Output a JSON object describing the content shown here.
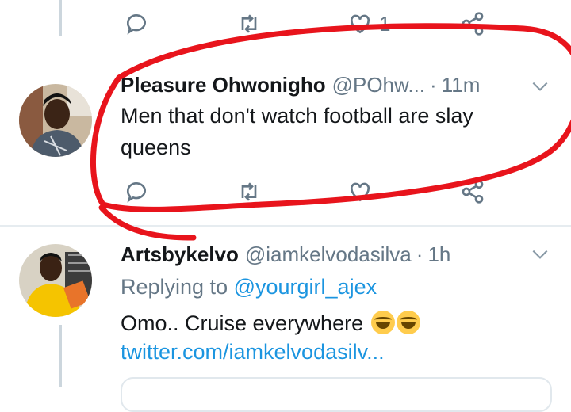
{
  "top_actions": {
    "like_count": "1"
  },
  "tweets": [
    {
      "name": "Pleasure Ohwonigho",
      "handle": "@POhw...",
      "time": "11m",
      "text_line1": "Men that don't watch football are slay",
      "text_line2": "queens"
    },
    {
      "name": "Artsbykelvo",
      "handle": "@iamkelvodasilva",
      "time": "1h",
      "replying_prefix": "Replying to",
      "replying_to": "@yourgirl_ajex",
      "text": "Omo.. Cruise everywhere",
      "emoji": "laughing-emoji",
      "link": "twitter.com/iamkelvodasilv..."
    }
  ],
  "separator": "·",
  "colors": {
    "accent": "#1b95e0",
    "muted": "#657786",
    "annotation": "#e8141c"
  }
}
